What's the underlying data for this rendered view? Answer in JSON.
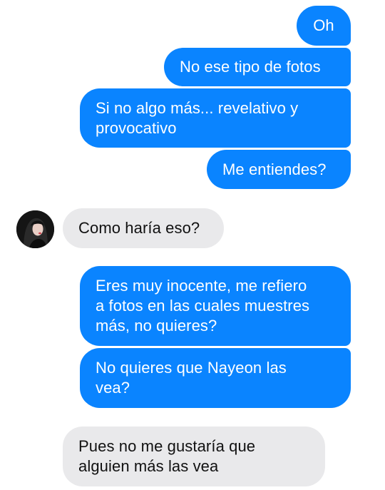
{
  "colors": {
    "outgoing_bubble": "#0a84ff",
    "incoming_bubble": "#e9e9eb",
    "outgoing_text": "#ffffff",
    "incoming_text": "#111111"
  },
  "contact": {
    "avatar_icon": "avatar-photo-icon"
  },
  "messages": [
    {
      "sender": "me",
      "text": "Oh"
    },
    {
      "sender": "me",
      "text": "No ese tipo de fotos"
    },
    {
      "sender": "me",
      "text": "Si no algo más... revelativo y\nprovocativo"
    },
    {
      "sender": "me",
      "text": "Me entiendes?"
    },
    {
      "sender": "contact",
      "text": "Como haría eso?"
    },
    {
      "sender": "me",
      "text": "Eres muy inocente, me refiero\na fotos en las cuales muestres\nmás, no quieres?"
    },
    {
      "sender": "me",
      "text": "No quieres que Nayeon las\nvea?"
    },
    {
      "sender": "contact",
      "text": "Pues no me gustaría que\nalguien más las vea"
    }
  ]
}
